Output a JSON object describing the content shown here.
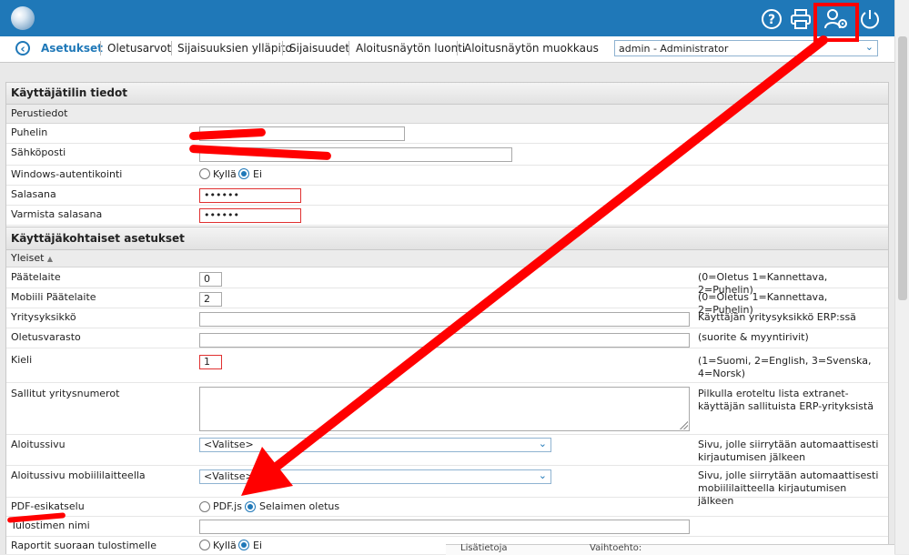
{
  "topbar": {
    "icons": [
      "help-icon",
      "print-icon",
      "user-settings-icon",
      "power-icon"
    ]
  },
  "nav": {
    "items": [
      "Asetukset",
      "Oletusarvot",
      "Sijaisuuksien ylläpito",
      "Sijaisuudet",
      "Aloitusnäytön luonti",
      "Aloitusnäytön muokkaus"
    ],
    "user_select": "admin - Administrator"
  },
  "account": {
    "title": "Käyttäjätilin tiedot",
    "basic": "Perustiedot",
    "phone": "Puhelin",
    "email": "Sähköposti",
    "windows_auth": "Windows-autentikointi",
    "yes": "Kyllä",
    "no": "Ei",
    "password": "Salasana",
    "password_value": "••••••",
    "confirm_password": "Varmista salasana",
    "confirm_value": "••••••"
  },
  "user_settings": {
    "title": "Käyttäjäkohtaiset asetukset",
    "general": "Yleiset",
    "general_arrow": "▲",
    "rows": {
      "device": {
        "label": "Päätelaite",
        "value": "0",
        "hint": "(0=Oletus 1=Kannettava, 2=Puhelin)"
      },
      "mobile_device": {
        "label": "Mobiili Päätelaite",
        "value": "2",
        "hint": "(0=Oletus 1=Kannettava, 2=Puhelin)"
      },
      "unit": {
        "label": "Yritysyksikkö",
        "value": "",
        "hint": "Käyttäjän yritysyksikkö ERP:ssä"
      },
      "warehouse": {
        "label": "Oletusvarasto",
        "value": "",
        "hint": "(suorite & myyntirivit)"
      },
      "language": {
        "label": "Kieli",
        "value": "1",
        "hint": "(1=Suomi, 2=English, 3=Svenska, 4=Norsk)"
      },
      "companies": {
        "label": "Sallitut yritysnumerot",
        "hint": "Pilkulla eroteltu lista extranet-käyttäjän sallituista ERP-yrityksistä"
      },
      "start_page": {
        "label": "Aloitussivu",
        "value": "<Valitse>",
        "hint": "Sivu, jolle siirrytään automaattisesti kirjautumisen jälkeen"
      },
      "start_page_mobile": {
        "label": "Aloitussivu mobiililaitteella",
        "value": "<Valitse>",
        "hint": "Sivu, jolle siirrytään automaattisesti mobiililaitteella kirjautumisen jälkeen"
      },
      "pdf_preview": {
        "label": "PDF-esikatselu",
        "opt1": "PDF.js",
        "opt2": "Selaimen oletus"
      },
      "printer_name": {
        "label": "Tulostimen nimi"
      },
      "direct_print": {
        "label": "Raportit suoraan tulostimelle",
        "yes": "Kyllä",
        "no": "Ei"
      }
    }
  },
  "bottom": {
    "left": "Lisätietoja",
    "right": "Vaihtoehto:"
  },
  "colors": {
    "topbar": "#1f78b8",
    "annotation": "#ff0000"
  }
}
